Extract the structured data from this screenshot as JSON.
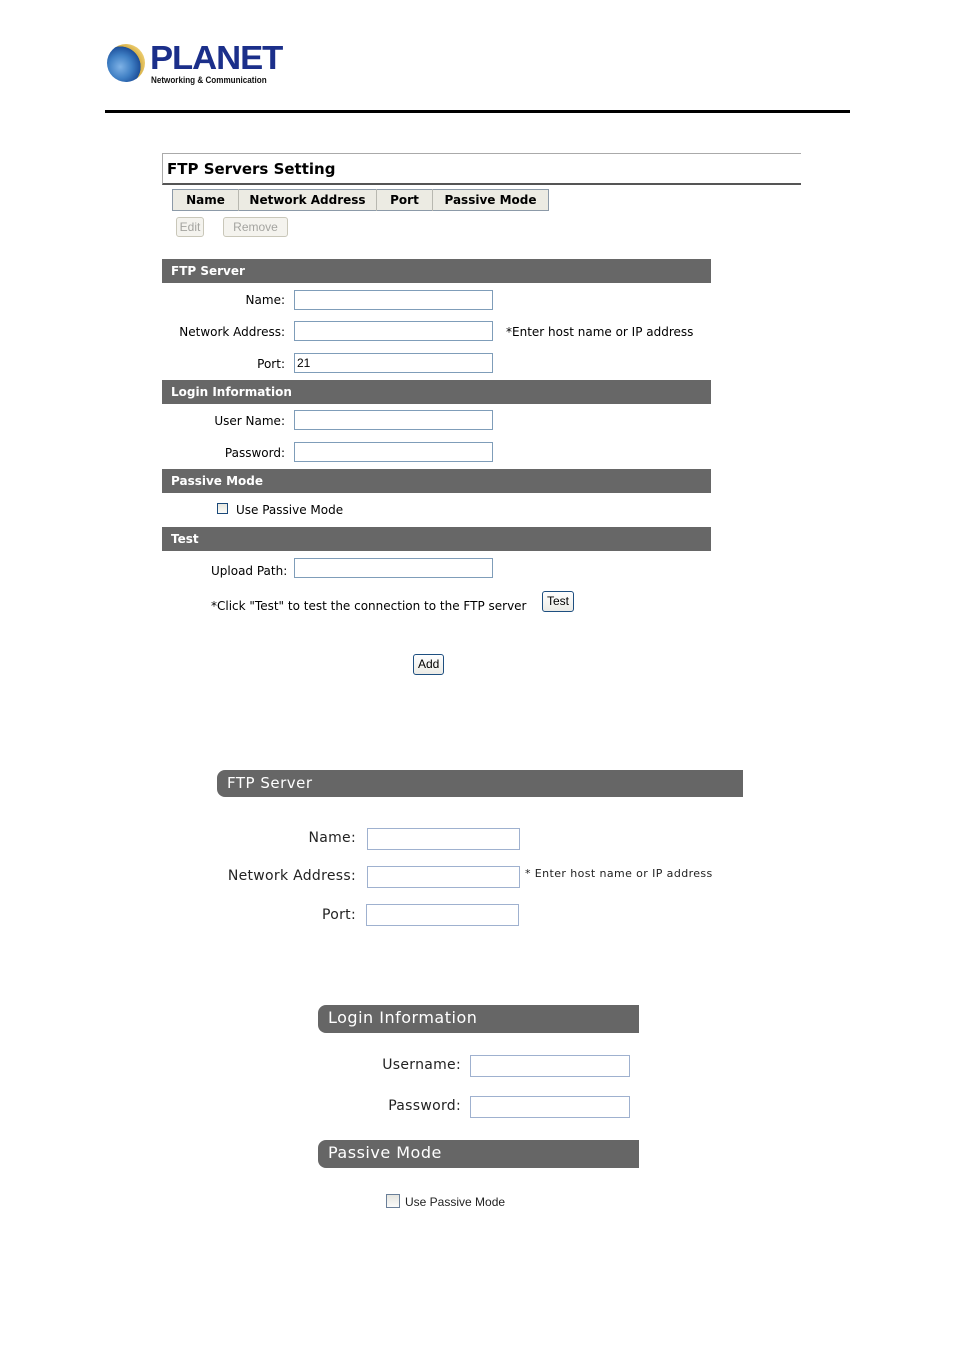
{
  "header": {
    "logo_word": "PLANET",
    "logo_tagline": "Networking & Communication"
  },
  "screen1": {
    "title": "FTP Servers Setting",
    "table_columns": [
      "Name",
      "Network Address",
      "Port",
      "Passive Mode"
    ],
    "edit_button": "Edit",
    "remove_button": "Remove",
    "ftp_server": {
      "section_title": "FTP Server",
      "name_label": "Name:",
      "name_value": "",
      "address_label": "Network Address:",
      "address_value": "",
      "address_hint": "*Enter host name or IP address",
      "port_label": "Port:",
      "port_value": "21"
    },
    "login": {
      "section_title": "Login Information",
      "username_label": "User Name:",
      "username_value": "",
      "password_label": "Password:",
      "password_value": ""
    },
    "passive": {
      "section_title": "Passive Mode",
      "checkbox_label": "Use Passive Mode",
      "checked": false
    },
    "test": {
      "section_title": "Test",
      "upload_path_label": "Upload Path:",
      "upload_path_value": "",
      "instruction": "*Click \"Test\" to test the connection to the FTP server",
      "test_button": "Test"
    },
    "add_button": "Add"
  },
  "screen2": {
    "ftp_server": {
      "section_title": "FTP Server",
      "name_label": "Name:",
      "address_label": "Network Address:",
      "address_hint": "* Enter host name or IP address",
      "port_label": "Port:"
    },
    "login": {
      "section_title": "Login Information",
      "username_label": "Username:",
      "password_label": "Password:"
    },
    "passive": {
      "section_title": "Passive Mode",
      "checkbox_label": "Use Passive Mode",
      "checked": false
    }
  },
  "colors": {
    "section_bar": "#676767",
    "logo_blue": "#1b2f8a",
    "input_border": "#7f9db9"
  }
}
